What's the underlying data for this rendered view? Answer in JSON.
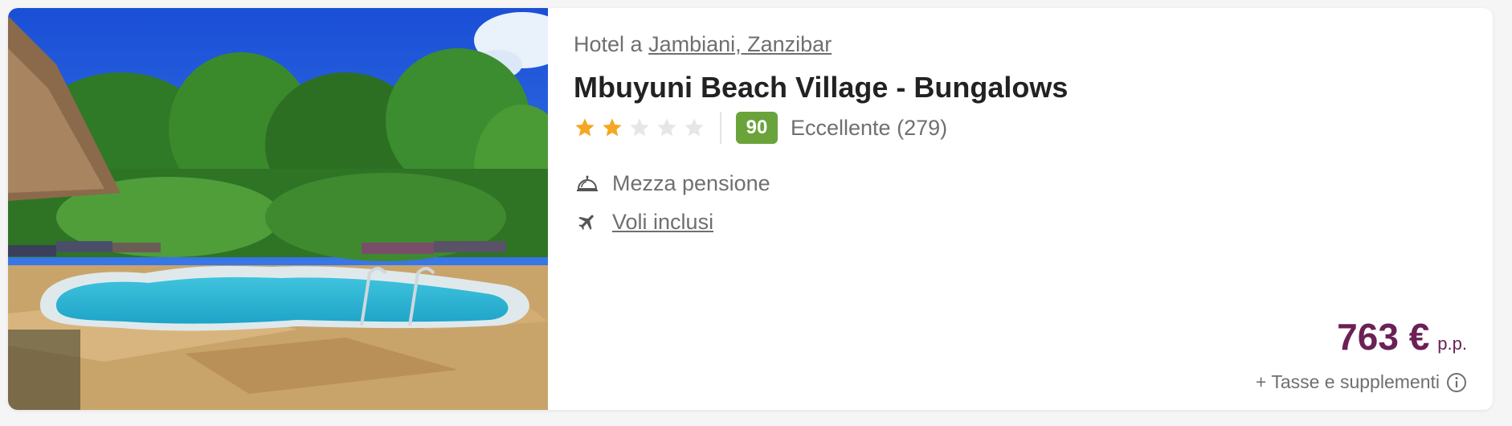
{
  "hotel": {
    "type_prefix": "Hotel a",
    "location": "Jambiani, Zanzibar",
    "name": "Mbuyuni Beach Village - Bungalows",
    "stars": 2,
    "max_stars": 5,
    "score": "90",
    "score_label": "Eccellente (279)",
    "score_color": "#6ba33b",
    "star_color": "#f5a623",
    "star_empty_color": "#e6e6e6"
  },
  "features": {
    "board": {
      "label": "Mezza pensione",
      "icon": "room-service-bell-icon"
    },
    "flights": {
      "label": "Voli inclusi",
      "icon": "plane-icon"
    }
  },
  "price": {
    "amount": "763 €",
    "unit": "p.p.",
    "taxes": "+ Tasse e supplementi",
    "color": "#6b2155"
  }
}
